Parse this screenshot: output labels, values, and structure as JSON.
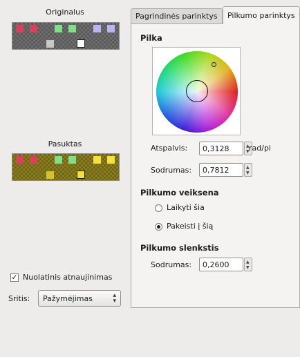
{
  "left": {
    "original_label": "Originalus",
    "rotated_label": "Pasuktas",
    "continuous_update_label": "Nuolatinis atnaujinimas",
    "continuous_update_checked": true,
    "area_label": "Sritis:",
    "area_value": "Pažymėjimas"
  },
  "tabs": [
    {
      "label": "Pagrindinės parinktys",
      "active": false
    },
    {
      "label": "Pilkumo parinktys",
      "active": true
    }
  ],
  "gray": {
    "section_title": "Pilka",
    "hue_label": "Atspalvis:",
    "hue_value": "0,3128",
    "hue_unit": "rad/pi",
    "saturation_label": "Sodrumas:",
    "saturation_value": "0,7812"
  },
  "gray_mode": {
    "section_title": "Pilkumo veiksena",
    "option_keep": "Laikyti šia",
    "option_change": "Pakeisti į šią",
    "selected": "option_change"
  },
  "gray_threshold": {
    "section_title": "Pilkumo slenkstis",
    "saturation_label": "Sodrumas:",
    "saturation_value": "0,2600"
  },
  "colors": {
    "swatch_red": "#d9405a",
    "swatch_green": "#7ee08a",
    "swatch_violet": "#b7b6f2",
    "swatch_yellow": "#f2e23a",
    "swatch_white": "#ffffff",
    "swatch_gray": "#c8c8c8"
  }
}
